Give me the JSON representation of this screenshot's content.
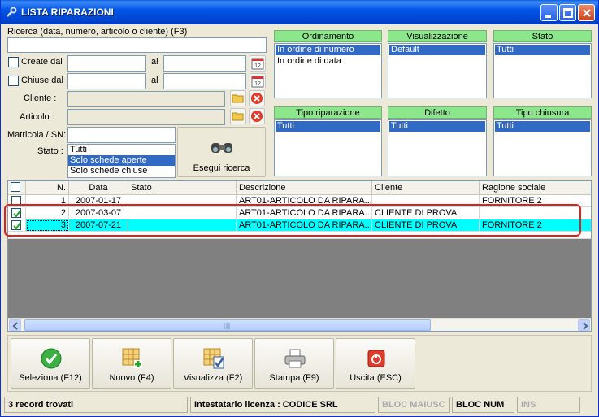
{
  "window": {
    "title": "LISTA RIPARAZIONI"
  },
  "search": {
    "label": "Ricerca (data, numero, articolo o cliente) (F3)",
    "value": "",
    "created_label": "Create dal",
    "closed_label": "Chiuse dal",
    "al": "al",
    "calendar_day": "12",
    "cliente_label": "Cliente :",
    "articolo_label": "Articolo :",
    "matricola_label": "Matricola / SN:",
    "stato_label": "Stato :",
    "stato_options": [
      "Tutti",
      "Solo schede aperte",
      "Solo schede chiuse"
    ],
    "stato_selected": "Solo schede aperte",
    "search_button": "Esegui ricerca"
  },
  "panels": {
    "ordinamento": {
      "title": "Ordinamento",
      "items": [
        "In ordine di numero",
        "In ordine di data"
      ],
      "selected": "In ordine di numero"
    },
    "visualizzazione": {
      "title": "Visualizzazione",
      "items": [
        "Default"
      ],
      "selected": "Default"
    },
    "stato": {
      "title": "Stato",
      "items": [
        "Tutti"
      ],
      "selected": "Tutti"
    },
    "tipo_riparazione": {
      "title": "Tipo riparazione",
      "items": [
        "Tutti"
      ],
      "selected": "Tutti"
    },
    "difetto": {
      "title": "Difetto",
      "items": [
        "Tutti"
      ],
      "selected": "Tutti"
    },
    "tipo_chiusura": {
      "title": "Tipo chiusura",
      "items": [
        "Tutti"
      ],
      "selected": "Tutti"
    }
  },
  "grid": {
    "columns": [
      "N.",
      "Data",
      "Stato",
      "Descrizione",
      "Cliente",
      "Ragione sociale"
    ],
    "rows": [
      {
        "checked": false,
        "n": "1",
        "data": "2007-01-17",
        "stato": "",
        "descrizione": "ART01-ARTICOLO DA RIPARA...",
        "cliente": "",
        "ragione": "FORNITORE 2"
      },
      {
        "checked": true,
        "n": "2",
        "data": "2007-03-07",
        "stato": "",
        "descrizione": "ART01-ARTICOLO DA RIPARA...",
        "cliente": "CLIENTE DI PROVA",
        "ragione": ""
      },
      {
        "checked": true,
        "n": "3",
        "data": "2007-07-21",
        "stato": "",
        "descrizione": "ART01-ARTICOLO DA RIPARA...",
        "cliente": "CLIENTE DI PROVA",
        "ragione": "FORNITORE 2"
      }
    ],
    "selected_row": 2
  },
  "toolbar": {
    "seleziona": "Seleziona (F12)",
    "nuovo": "Nuovo (F4)",
    "visualizza": "Visualizza (F2)",
    "stampa": "Stampa (F9)",
    "uscita": "Uscita (ESC)"
  },
  "status": {
    "records": "3 record trovati",
    "license": "Intestatario licenza : CODICE SRL",
    "caps": "BLOC MAIUSC",
    "num": "BLOC NUM",
    "ins": "INS"
  },
  "colors": {
    "panel_header": "#8ce68c",
    "selection": "#316ac5",
    "selected_row": "#00ffff",
    "highlight_outline": "#e0201a"
  }
}
